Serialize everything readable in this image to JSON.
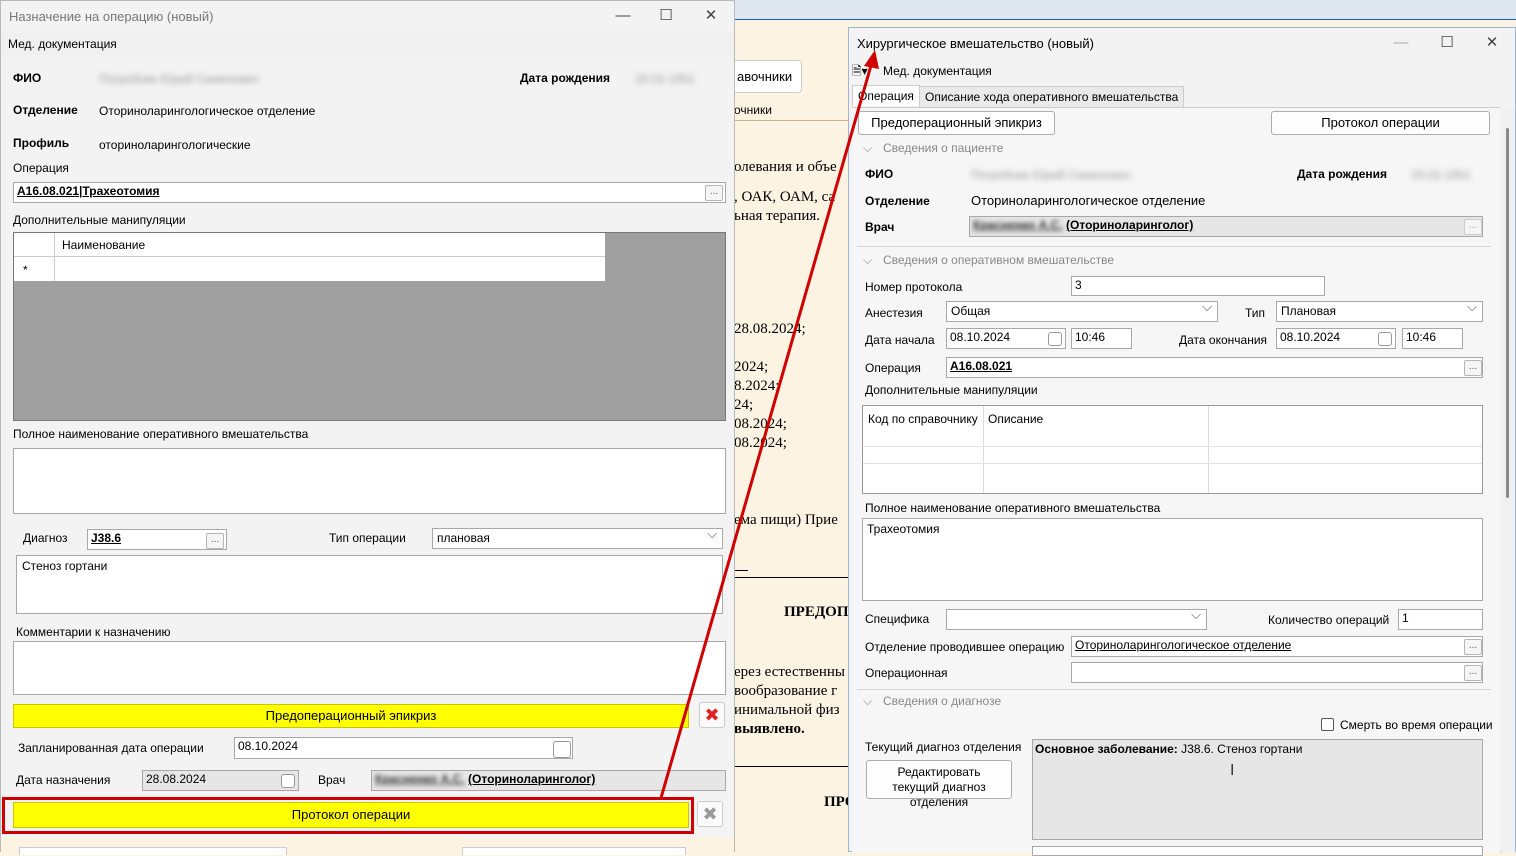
{
  "background_doc": {
    "button_label": "авочники",
    "tab_label": "очники",
    "lines": [
      "олевания и объе",
      ", ОАК, ОАМ, са",
      "ьная терапия.",
      "28.08.2024;",
      "2024;",
      "8.2024;",
      "24;",
      "08.2024;",
      "08.2024;",
      "ема пищи) Прие",
      "ПРЕДОП",
      "ерез естественны",
      "вообразование г",
      "инимальной физ",
      "выявлено.",
      "ПРО"
    ]
  },
  "left_window": {
    "title": "Назначение на операцию (новый)",
    "menu": "Мед. документация",
    "fio_label": "ФИО",
    "fio_value": "Погребняк Юрий Семенович",
    "dob_label": "Дата рождения",
    "dob_value": "20.02.1951",
    "department_label": "Отделение",
    "department_value": "Оториноларингологическое отделение",
    "profile_label": "Профиль",
    "profile_value": "оториноларингологические",
    "operation_label": "Операция",
    "operation_value": "A16.08.021|Трахеотомия",
    "extra_manip_label": "Дополнительные манипуляции",
    "grid_header": "Наименование",
    "grid_new_row_marker": "*",
    "full_name_label": "Полное наименование оперативного вмешательства",
    "full_name_value": "",
    "diagnosis_label": "Диагноз",
    "diagnosis_value": "J38.6",
    "op_type_label": "Тип операции",
    "op_type_value": "плановая",
    "diagnosis_text": "Стеноз гортани",
    "comments_label": "Комментарии к назначению",
    "comments_value": "",
    "preop_button": "Предоперационный эпикриз",
    "planned_date_label": "Запланированная дата операции",
    "planned_date_value": "08.10.2024",
    "assign_date_label": "Дата назначения",
    "assign_date_value": "28.08.2024",
    "doctor_label": "Врач",
    "doctor_name": "Красненко А.С.",
    "doctor_role": "(Оториноларинголог)",
    "protocol_button": "Протокол операции"
  },
  "right_window": {
    "title": "Хирургическое вмешательство (новый)",
    "menu": "Мед. документация",
    "tabs": [
      "Операция",
      "Описание хода оперативного вмешательства"
    ],
    "preop_button": "Предоперационный эпикриз",
    "protocol_button": "Протокол операции",
    "section_patient": "Сведения о пациенте",
    "fio_label": "ФИО",
    "fio_value": "Погребняк Юрий Семенович",
    "dob_label": "Дата рождения",
    "dob_value": "20.02.1951",
    "department_label": "Отделение",
    "department_value": "Оториноларингологическое отделение",
    "doctor_label": "Врач",
    "doctor_name": "Красненко А.С.",
    "doctor_role": "(Оториноларинголог)",
    "section_surgery": "Сведения о оперативном вмешательстве",
    "protocol_num_label": "Номер протокола",
    "protocol_num_value": "3",
    "anesthesia_label": "Анестезия",
    "anesthesia_value": "Общая",
    "type_label": "Тип",
    "type_value": "Плановая",
    "start_label": "Дата начала",
    "start_date": "08.10.2024",
    "start_time": "10:46",
    "end_label": "Дата окончания",
    "end_date": "08.10.2024",
    "end_time": "10:46",
    "operation_label": "Операция",
    "operation_value": "A16.08.021",
    "extra_manip_label": "Дополнительные манипуляции",
    "grid_col1": "Код по справочнику",
    "grid_col2": "Описание",
    "full_name_label": "Полное наименование оперативного вмешательства",
    "full_name_value": "Трахеотомия",
    "specifics_label": "Специфика",
    "specifics_value": "",
    "count_label": "Количество операций",
    "count_value": "1",
    "dept_performed_label": "Отделение проводившее операцию",
    "dept_performed_value": "Оториноларингологическое отделение",
    "operating_room_label": "Операционная",
    "operating_room_value": "",
    "section_diagnosis": "Сведения о диагнозе",
    "death_label": "Смерть во время операции",
    "current_diag_label": "Текущий диагноз отделения",
    "edit_diag_button": "Редактировать текущий диагноз отделения",
    "diag_main_label": "Основное заболевание:",
    "diag_main_value": " J38.6. Стеноз гортани"
  },
  "colors": {
    "highlight_yellow": "#ffff00",
    "annotation_red": "#d00000"
  }
}
